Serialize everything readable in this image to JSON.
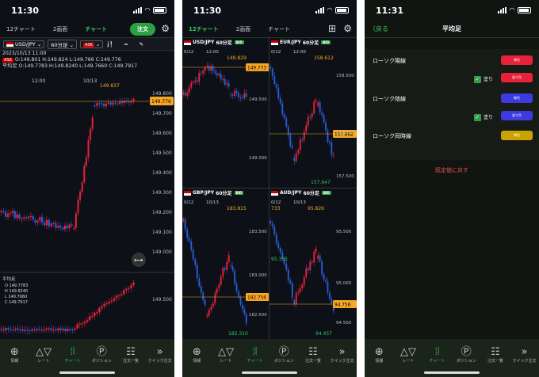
{
  "phone1": {
    "time": "11:30",
    "tabs": [
      "12チャート",
      "2画面",
      "チャート"
    ],
    "order_btn": "注文",
    "pair": "USD/JPY",
    "timeframe": "60分足",
    "indicator": "ASK",
    "info_date": "2023/10/13 11:00",
    "info_ask": "ASK",
    "info_ohlc": "O:149.801  H:149.824  L:149.766  C:149.776",
    "info_avg_label": "平均足",
    "info_avg": "O:149.7783 H:149.8240 L:149.7660 C:149.7917",
    "x_labels": [
      "12:00",
      "10/13"
    ],
    "high_label": "149.837",
    "current_price": "149.776",
    "y_labels": [
      "149.800",
      "149.700",
      "149.600",
      "149.500",
      "149.400",
      "149.300",
      "149.200",
      "149.100",
      "149.000"
    ],
    "sub_title": "平均足",
    "sub_ohlc": [
      "O 149.7783",
      "H 149.8240",
      "L 149.7660",
      "C 149.7917"
    ],
    "sub_y": "149.500"
  },
  "phone2": {
    "time": "11:30",
    "tabs": [
      "12チャート",
      "2画面",
      "チャート"
    ],
    "panes": [
      {
        "pair": "USD/JPY",
        "tf": "60分足",
        "bid": "BID",
        "x": [
          "0/12",
          "12:00"
        ],
        "high": "149.829",
        "current": "149.773",
        "y": [
          "149.500",
          "149.000"
        ],
        "low": ""
      },
      {
        "pair": "EUR/JPY",
        "tf": "60分足",
        "bid": "BID",
        "x": [
          "0/12",
          "12:00"
        ],
        "high": "158.612",
        "current": "157.882",
        "y": [
          "158.500",
          "158.000",
          "157.500"
        ],
        "low": "157.647"
      },
      {
        "pair": "GBP/JPY",
        "tf": "60分足",
        "bid": "BID",
        "x": [
          "0/12",
          "10/13"
        ],
        "high": "183.815",
        "current": "182.756",
        "y": [
          "183.500",
          "183.000",
          "182.500"
        ],
        "low": "182.310"
      },
      {
        "pair": "AUD/JPY",
        "tf": "60分足",
        "bid": "BID",
        "x": [
          "0/12",
          "10/13"
        ],
        "high": "95.826",
        "high2": "733",
        "current": "94.758",
        "y": [
          "95.500",
          "95.000",
          "94.500"
        ],
        "low": "94.457",
        "low2": "95.335"
      }
    ]
  },
  "phone3": {
    "time": "11:31",
    "back": "戻る",
    "title": "平均足",
    "items": [
      {
        "label": "ローソク陽線",
        "sw1": "線色",
        "sw2": "塗り色",
        "fill": "塗り"
      },
      {
        "label": "ローソク陰線",
        "sw1": "線色",
        "sw2": "塗り色",
        "fill": "塗り"
      },
      {
        "label": "ローソク同時線",
        "sw1": "線色"
      }
    ],
    "reset": "既定値に戻す"
  },
  "nav": [
    "情報",
    "レート",
    "チャート",
    "ポジション",
    "注文一覧",
    "クイック注文"
  ],
  "colors": {
    "up": "#e8213a",
    "down": "#2a5bd7",
    "accent": "#34c759",
    "price": "#f5a623"
  }
}
